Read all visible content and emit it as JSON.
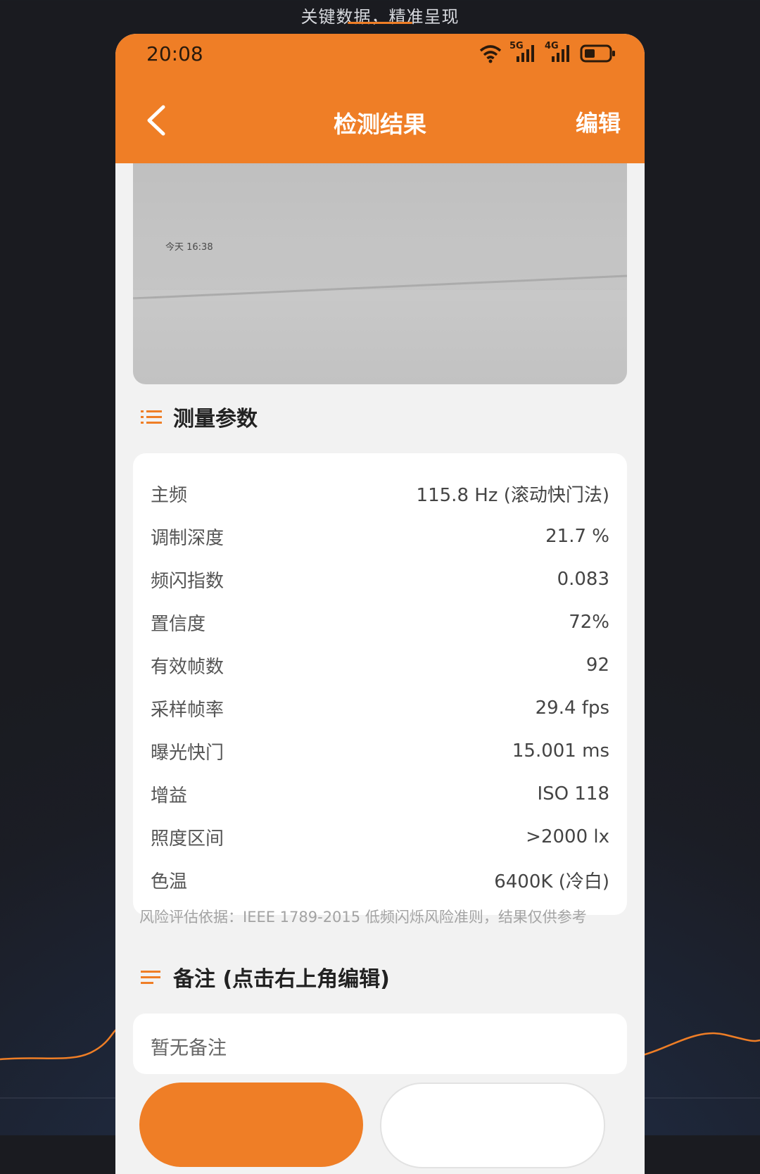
{
  "promo": {
    "caption": "关键数据，精准呈现"
  },
  "status_bar": {
    "time": "20:08",
    "net1": "5G",
    "net2": "4G"
  },
  "nav": {
    "title": "检测结果",
    "edit_label": "编辑"
  },
  "photo": {
    "caption": "今天 16:38"
  },
  "params_section": {
    "title": "测量参数",
    "rows": [
      {
        "label": "主频",
        "value": "115.8 Hz (滚动快门法)"
      },
      {
        "label": "调制深度",
        "value": "21.7 %"
      },
      {
        "label": "频闪指数",
        "value": "0.083"
      },
      {
        "label": "置信度",
        "value": "72%"
      },
      {
        "label": "有效帧数",
        "value": "92"
      },
      {
        "label": "采样帧率",
        "value": "29.4 fps"
      },
      {
        "label": "曝光快门",
        "value": "15.001 ms"
      },
      {
        "label": "增益",
        "value": "ISO 118"
      },
      {
        "label": "照度区间",
        "value": ">2000 lx"
      },
      {
        "label": "色温",
        "value": "6400K (冷白)"
      }
    ]
  },
  "risk_note": "风险评估依据：IEEE 1789-2015 低频闪烁风险准则，结果仅供参考",
  "remark_section": {
    "title": "备注 (点击右上角编辑)",
    "placeholder": "暂无备注"
  },
  "colors": {
    "accent": "#ef7e26",
    "page_bg": "#f2f2f2",
    "card": "#ffffff",
    "backdrop": "#1b1d25"
  }
}
